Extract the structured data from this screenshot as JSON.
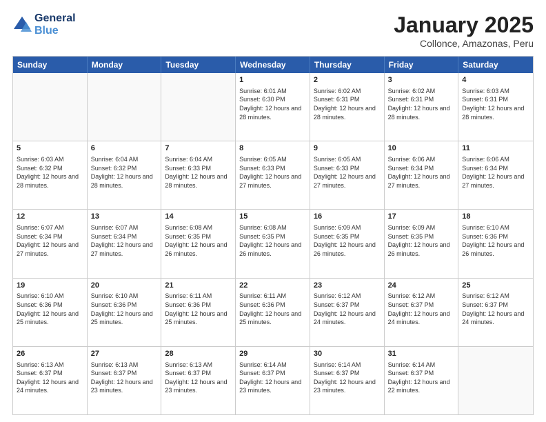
{
  "header": {
    "logo_line1": "General",
    "logo_line2": "Blue",
    "month": "January 2025",
    "location": "Collonce, Amazonas, Peru"
  },
  "day_headers": [
    "Sunday",
    "Monday",
    "Tuesday",
    "Wednesday",
    "Thursday",
    "Friday",
    "Saturday"
  ],
  "weeks": [
    [
      {
        "num": "",
        "info": ""
      },
      {
        "num": "",
        "info": ""
      },
      {
        "num": "",
        "info": ""
      },
      {
        "num": "1",
        "info": "Sunrise: 6:01 AM\nSunset: 6:30 PM\nDaylight: 12 hours\nand 28 minutes."
      },
      {
        "num": "2",
        "info": "Sunrise: 6:02 AM\nSunset: 6:31 PM\nDaylight: 12 hours\nand 28 minutes."
      },
      {
        "num": "3",
        "info": "Sunrise: 6:02 AM\nSunset: 6:31 PM\nDaylight: 12 hours\nand 28 minutes."
      },
      {
        "num": "4",
        "info": "Sunrise: 6:03 AM\nSunset: 6:31 PM\nDaylight: 12 hours\nand 28 minutes."
      }
    ],
    [
      {
        "num": "5",
        "info": "Sunrise: 6:03 AM\nSunset: 6:32 PM\nDaylight: 12 hours\nand 28 minutes."
      },
      {
        "num": "6",
        "info": "Sunrise: 6:04 AM\nSunset: 6:32 PM\nDaylight: 12 hours\nand 28 minutes."
      },
      {
        "num": "7",
        "info": "Sunrise: 6:04 AM\nSunset: 6:33 PM\nDaylight: 12 hours\nand 28 minutes."
      },
      {
        "num": "8",
        "info": "Sunrise: 6:05 AM\nSunset: 6:33 PM\nDaylight: 12 hours\nand 27 minutes."
      },
      {
        "num": "9",
        "info": "Sunrise: 6:05 AM\nSunset: 6:33 PM\nDaylight: 12 hours\nand 27 minutes."
      },
      {
        "num": "10",
        "info": "Sunrise: 6:06 AM\nSunset: 6:34 PM\nDaylight: 12 hours\nand 27 minutes."
      },
      {
        "num": "11",
        "info": "Sunrise: 6:06 AM\nSunset: 6:34 PM\nDaylight: 12 hours\nand 27 minutes."
      }
    ],
    [
      {
        "num": "12",
        "info": "Sunrise: 6:07 AM\nSunset: 6:34 PM\nDaylight: 12 hours\nand 27 minutes."
      },
      {
        "num": "13",
        "info": "Sunrise: 6:07 AM\nSunset: 6:34 PM\nDaylight: 12 hours\nand 27 minutes."
      },
      {
        "num": "14",
        "info": "Sunrise: 6:08 AM\nSunset: 6:35 PM\nDaylight: 12 hours\nand 26 minutes."
      },
      {
        "num": "15",
        "info": "Sunrise: 6:08 AM\nSunset: 6:35 PM\nDaylight: 12 hours\nand 26 minutes."
      },
      {
        "num": "16",
        "info": "Sunrise: 6:09 AM\nSunset: 6:35 PM\nDaylight: 12 hours\nand 26 minutes."
      },
      {
        "num": "17",
        "info": "Sunrise: 6:09 AM\nSunset: 6:35 PM\nDaylight: 12 hours\nand 26 minutes."
      },
      {
        "num": "18",
        "info": "Sunrise: 6:10 AM\nSunset: 6:36 PM\nDaylight: 12 hours\nand 26 minutes."
      }
    ],
    [
      {
        "num": "19",
        "info": "Sunrise: 6:10 AM\nSunset: 6:36 PM\nDaylight: 12 hours\nand 25 minutes."
      },
      {
        "num": "20",
        "info": "Sunrise: 6:10 AM\nSunset: 6:36 PM\nDaylight: 12 hours\nand 25 minutes."
      },
      {
        "num": "21",
        "info": "Sunrise: 6:11 AM\nSunset: 6:36 PM\nDaylight: 12 hours\nand 25 minutes."
      },
      {
        "num": "22",
        "info": "Sunrise: 6:11 AM\nSunset: 6:36 PM\nDaylight: 12 hours\nand 25 minutes."
      },
      {
        "num": "23",
        "info": "Sunrise: 6:12 AM\nSunset: 6:37 PM\nDaylight: 12 hours\nand 24 minutes."
      },
      {
        "num": "24",
        "info": "Sunrise: 6:12 AM\nSunset: 6:37 PM\nDaylight: 12 hours\nand 24 minutes."
      },
      {
        "num": "25",
        "info": "Sunrise: 6:12 AM\nSunset: 6:37 PM\nDaylight: 12 hours\nand 24 minutes."
      }
    ],
    [
      {
        "num": "26",
        "info": "Sunrise: 6:13 AM\nSunset: 6:37 PM\nDaylight: 12 hours\nand 24 minutes."
      },
      {
        "num": "27",
        "info": "Sunrise: 6:13 AM\nSunset: 6:37 PM\nDaylight: 12 hours\nand 23 minutes."
      },
      {
        "num": "28",
        "info": "Sunrise: 6:13 AM\nSunset: 6:37 PM\nDaylight: 12 hours\nand 23 minutes."
      },
      {
        "num": "29",
        "info": "Sunrise: 6:14 AM\nSunset: 6:37 PM\nDaylight: 12 hours\nand 23 minutes."
      },
      {
        "num": "30",
        "info": "Sunrise: 6:14 AM\nSunset: 6:37 PM\nDaylight: 12 hours\nand 23 minutes."
      },
      {
        "num": "31",
        "info": "Sunrise: 6:14 AM\nSunset: 6:37 PM\nDaylight: 12 hours\nand 22 minutes."
      },
      {
        "num": "",
        "info": ""
      }
    ]
  ]
}
